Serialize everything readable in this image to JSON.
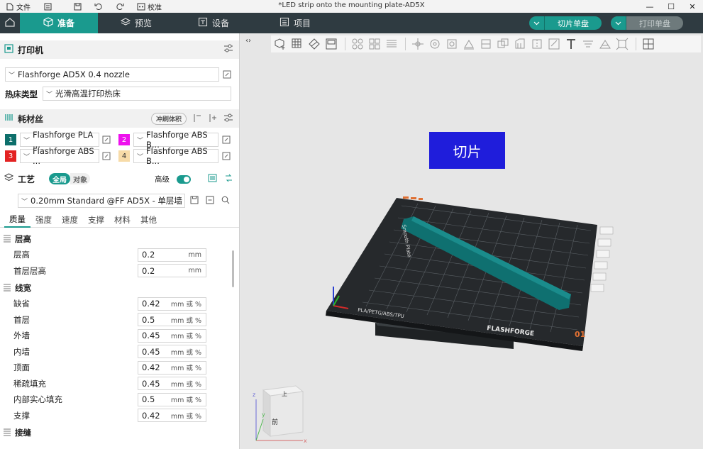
{
  "titlebar": {
    "file_label": "文件",
    "calibrate_label": "校准",
    "window_title": "*LED strip onto the mounting plate-AD5X"
  },
  "tabs": [
    {
      "label": "准备",
      "active": true
    },
    {
      "label": "预览"
    },
    {
      "label": "设备"
    },
    {
      "label": "项目"
    }
  ],
  "actions": {
    "slice_label": "切片单盘",
    "print_label": "打印单盘",
    "accent": "#1a9a8e",
    "print_disabled_color": "#8a8a8a"
  },
  "printer": {
    "section_title": "打印机",
    "printer_value": "Flashforge AD5X 0.4 nozzle",
    "bed_label": "热床类型",
    "bed_value": "光滑高温打印热床"
  },
  "filament": {
    "section_title": "耗材丝",
    "flush_label": "冲刷体积",
    "items": [
      {
        "num": "1",
        "color": "#0d6f6b",
        "name": "Flashforge PLA ..."
      },
      {
        "num": "2",
        "color": "#ee11ee",
        "name": "Flashforge ABS B..."
      },
      {
        "num": "3",
        "color": "#e32222",
        "name": "Flashforge ABS ..."
      },
      {
        "num": "4",
        "color": "#f7dba8",
        "name": "Flashforge ABS B..."
      }
    ]
  },
  "process": {
    "section_title": "工艺",
    "global_label": "全局",
    "object_label": "对象",
    "advanced_label": "高级",
    "profile_value": "0.20mm Standard @FF AD5X - 单层墙",
    "subtabs": [
      "质量",
      "强度",
      "速度",
      "支撑",
      "材料",
      "其他"
    ],
    "groups": {
      "layer_height": {
        "title": "层高",
        "rows": [
          {
            "label": "层高",
            "value": "0.2",
            "unit": "mm"
          },
          {
            "label": "首层层高",
            "value": "0.2",
            "unit": "mm"
          }
        ]
      },
      "line_width": {
        "title": "线宽",
        "rows": [
          {
            "label": "缺省",
            "value": "0.42",
            "unit": "mm 或 %"
          },
          {
            "label": "首层",
            "value": "0.5",
            "unit": "mm 或 %"
          },
          {
            "label": "外墙",
            "value": "0.45",
            "unit": "mm 或 %"
          },
          {
            "label": "内墙",
            "value": "0.45",
            "unit": "mm 或 %"
          },
          {
            "label": "顶面",
            "value": "0.42",
            "unit": "mm 或 %"
          },
          {
            "label": "稀疏填充",
            "value": "0.45",
            "unit": "mm 或 %"
          },
          {
            "label": "内部实心填充",
            "value": "0.5",
            "unit": "mm 或 %"
          },
          {
            "label": "支撑",
            "value": "0.42",
            "unit": "mm 或 %"
          }
        ]
      },
      "seam": {
        "title": "接缝"
      }
    }
  },
  "viewport": {
    "slice_overlay_label": "切片",
    "plate_texts": {
      "material_label": "PLA/PETG/ABS/TPU",
      "brand": "FLASHFORGE",
      "plate_number": "01",
      "side_label": "Smooth Plate"
    },
    "view_cube": {
      "top": "上",
      "front": "前",
      "axis_x": "x",
      "axis_y": "y",
      "axis_z": "z"
    }
  }
}
